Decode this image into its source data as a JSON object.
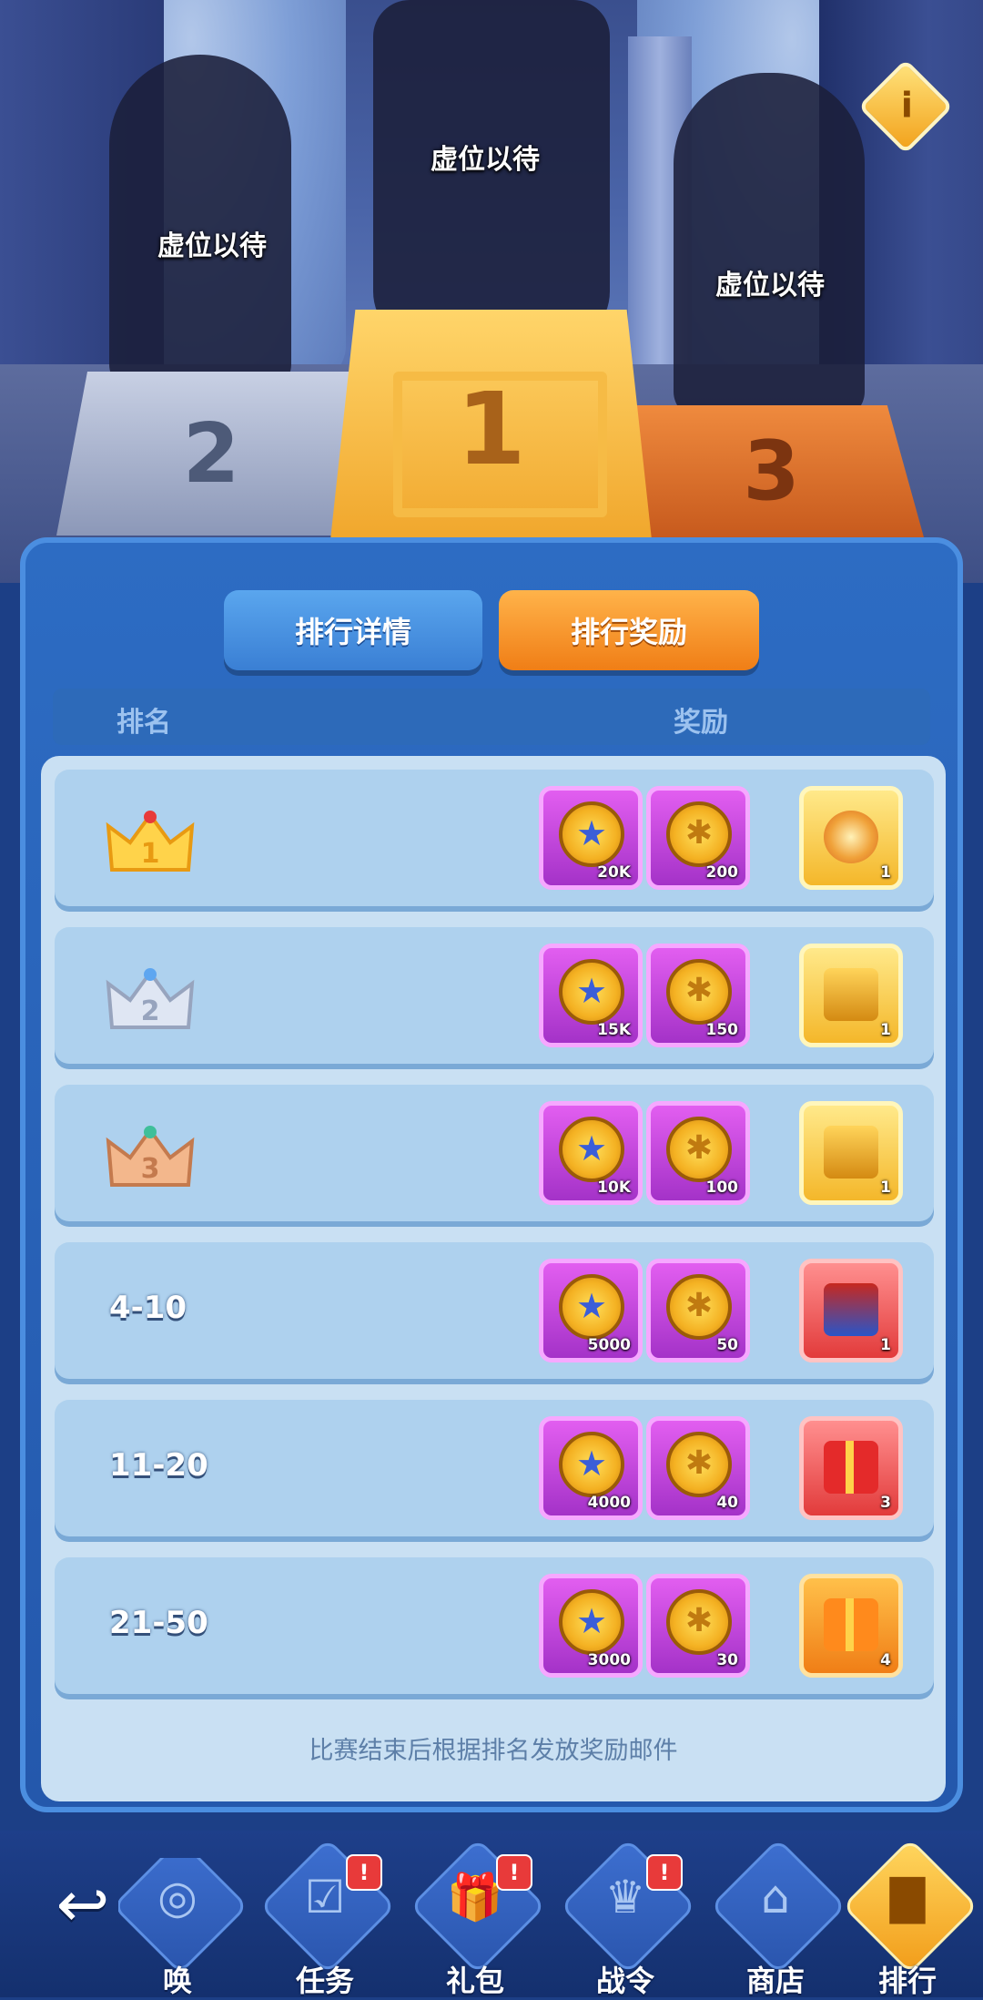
{
  "podium": {
    "first_label": "虚位以待",
    "second_label": "虚位以待",
    "third_label": "虚位以待",
    "first_number": "1",
    "second_number": "2",
    "third_number": "3"
  },
  "tabs": {
    "detail": "排行详情",
    "reward": "排行奖励",
    "active": "reward"
  },
  "table_header": {
    "rank": "排名",
    "reward": "奖励"
  },
  "rows": [
    {
      "rank": "1",
      "rank_type": "crown-gold",
      "rewards": [
        {
          "icon": "star-coin",
          "qty": "20K"
        },
        {
          "icon": "gold-badge",
          "qty": "200"
        },
        {
          "icon": "golden-tornado-card",
          "qty": "1"
        }
      ]
    },
    {
      "rank": "2",
      "rank_type": "crown-silver",
      "rewards": [
        {
          "icon": "star-coin",
          "qty": "15K"
        },
        {
          "icon": "gold-badge",
          "qty": "150"
        },
        {
          "icon": "gold-chest",
          "qty": "1"
        }
      ]
    },
    {
      "rank": "3",
      "rank_type": "crown-bronze",
      "rewards": [
        {
          "icon": "star-coin",
          "qty": "10K"
        },
        {
          "icon": "gold-badge",
          "qty": "100"
        },
        {
          "icon": "gold-chest",
          "qty": "1"
        }
      ]
    },
    {
      "rank": "4-10",
      "rank_type": "text",
      "rewards": [
        {
          "icon": "star-coin",
          "qty": "5000"
        },
        {
          "icon": "gold-badge",
          "qty": "50"
        },
        {
          "icon": "red-chest",
          "qty": "1"
        }
      ]
    },
    {
      "rank": "11-20",
      "rank_type": "text",
      "rewards": [
        {
          "icon": "star-coin",
          "qty": "4000"
        },
        {
          "icon": "gold-badge",
          "qty": "40"
        },
        {
          "icon": "red-gift",
          "qty": "3"
        }
      ]
    },
    {
      "rank": "21-50",
      "rank_type": "text",
      "rewards": [
        {
          "icon": "star-coin",
          "qty": "3000"
        },
        {
          "icon": "gold-badge",
          "qty": "30"
        },
        {
          "icon": "orange-gift",
          "qty": "4"
        }
      ]
    }
  ],
  "footer_note": "比赛结束后根据排名发放奖励邮件",
  "nav": {
    "back_icon": "back-arrow-icon",
    "items": [
      {
        "label": "唤",
        "icon": "summon-icon",
        "alert": false
      },
      {
        "label": "任务",
        "icon": "task-icon",
        "alert": true
      },
      {
        "label": "礼包",
        "icon": "gift-icon",
        "alert": true
      },
      {
        "label": "战令",
        "icon": "battle-pass-icon",
        "alert": true
      },
      {
        "label": "商店",
        "icon": "shop-icon",
        "alert": false
      },
      {
        "label": "排行",
        "icon": "ranking-icon",
        "alert": false
      }
    ],
    "alert_glyph": "!"
  },
  "colors": {
    "panel": "#2458ac",
    "active_tab": "#f07e16",
    "inactive_tab": "#3a7fd4",
    "row_bg": "#aed1ee"
  }
}
